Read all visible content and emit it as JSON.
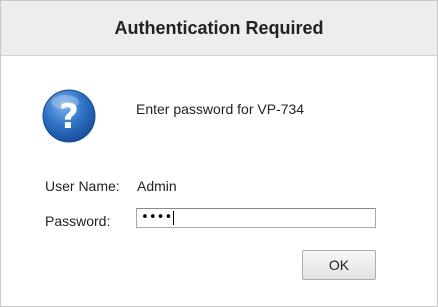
{
  "dialog": {
    "title": "Authentication Required",
    "message": "Enter password for VP-734",
    "icon": "help-icon",
    "icon_glyph": "?",
    "colors": {
      "icon_blue": "#2f73c4",
      "titlebar_bg": "#ededed"
    }
  },
  "form": {
    "username_label": "User Name:",
    "username_value": "Admin",
    "password_label": "Password:",
    "password_masked": "••••"
  },
  "buttons": {
    "ok_label": "OK"
  }
}
